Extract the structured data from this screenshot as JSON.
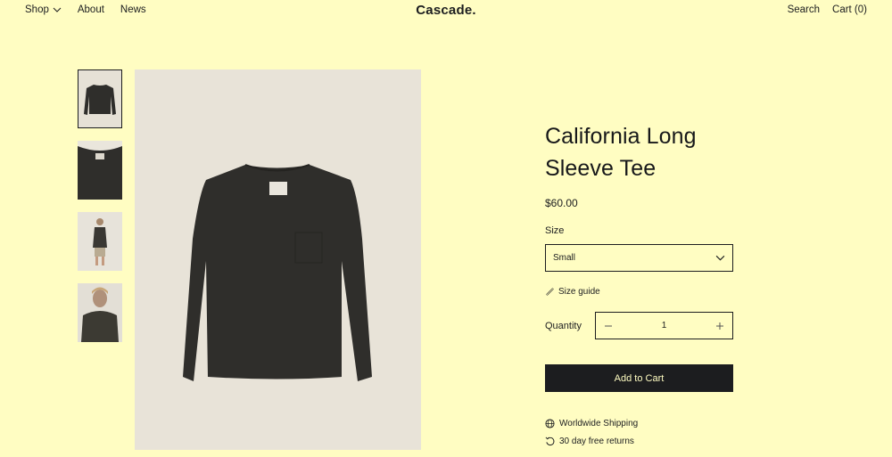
{
  "header": {
    "logo": "Cascade.",
    "nav": [
      {
        "label": "Shop",
        "icon": "chevron-down-icon"
      },
      {
        "label": "About"
      },
      {
        "label": "News"
      }
    ],
    "search_label": "Search",
    "cart_label": "Cart (0)"
  },
  "gallery": {
    "thumbnails": [
      {
        "name": "thumbnail-front-flat",
        "active": true
      },
      {
        "name": "thumbnail-collar-detail",
        "active": false
      },
      {
        "name": "thumbnail-model-full",
        "active": false
      },
      {
        "name": "thumbnail-model-closeup",
        "active": false
      }
    ]
  },
  "product": {
    "title_line1": "California Long",
    "title_line2": "Sleeve Tee",
    "price": "$60.00",
    "size_label": "Size",
    "size_value": "Small",
    "size_guide_label": "Size guide",
    "quantity_label": "Quantity",
    "quantity_value": "1",
    "add_to_cart_label": "Add to Cart",
    "features": [
      {
        "label": "Worldwide Shipping",
        "icon": "globe-icon"
      },
      {
        "label": "30 day free returns",
        "icon": "return-arrow-icon"
      }
    ]
  },
  "colors": {
    "background": "#fffdc2",
    "text": "#1c1d1f",
    "button": "#1c1d1f",
    "image_bg": "#e8e3d8",
    "shirt": "#2f2e2b"
  }
}
